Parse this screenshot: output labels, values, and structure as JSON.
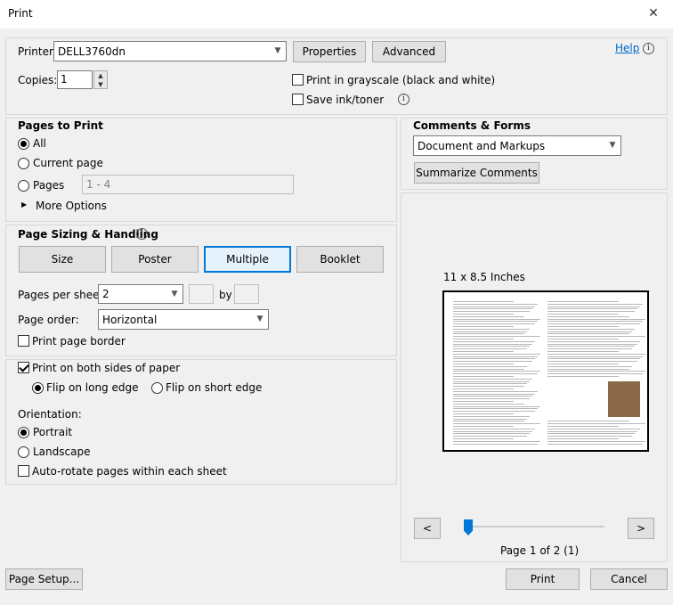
{
  "window": {
    "title": "Print",
    "close": "✕"
  },
  "printer": {
    "label": "Printer:",
    "value": "DELL3760dn",
    "properties_label": "Properties",
    "advanced_label": "Advanced",
    "help_label": "Help",
    "copies_label": "Copies:",
    "copies_value": "1",
    "grayscale_label": "Print in grayscale (black and white)",
    "grayscale_checked": false,
    "save_ink_label": "Save ink/toner",
    "save_ink_checked": false
  },
  "pages_to_print": {
    "heading": "Pages to Print",
    "all_label": "All",
    "current_label": "Current page",
    "pages_label": "Pages",
    "pages_value": "1 - 4",
    "more_options_label": "More Options",
    "selected": "All"
  },
  "comments_forms": {
    "heading": "Comments & Forms",
    "value": "Document and Markups",
    "summarize_label": "Summarize Comments"
  },
  "sizing": {
    "heading": "Page Sizing & Handling",
    "tabs": [
      "Size",
      "Poster",
      "Multiple",
      "Booklet"
    ],
    "selected_tab": "Multiple",
    "pages_per_sheet_label": "Pages per sheet:",
    "pages_per_sheet_value": "2",
    "by_label": "by",
    "page_order_label": "Page order:",
    "page_order_value": "Horizontal",
    "print_border_label": "Print page border",
    "print_border_checked": false
  },
  "duplex": {
    "both_sides_label": "Print on both sides of paper",
    "both_sides_checked": true,
    "long_edge_label": "Flip on long edge",
    "short_edge_label": "Flip on short edge",
    "selected": "long"
  },
  "orientation": {
    "label": "Orientation:",
    "portrait_label": "Portrait",
    "landscape_label": "Landscape",
    "selected": "Portrait",
    "auto_rotate_label": "Auto-rotate pages within each sheet",
    "auto_rotate_checked": false
  },
  "preview": {
    "size_label": "11 x 8.5 Inches",
    "prev_label": "<",
    "next_label": ">",
    "page_status": "Page 1 of 2 (1)",
    "slider_fraction": 0.0
  },
  "footer": {
    "page_setup_label": "Page Setup...",
    "print_label": "Print",
    "cancel_label": "Cancel"
  },
  "colors": {
    "accent": "#0078d7",
    "link": "#0066cc"
  }
}
